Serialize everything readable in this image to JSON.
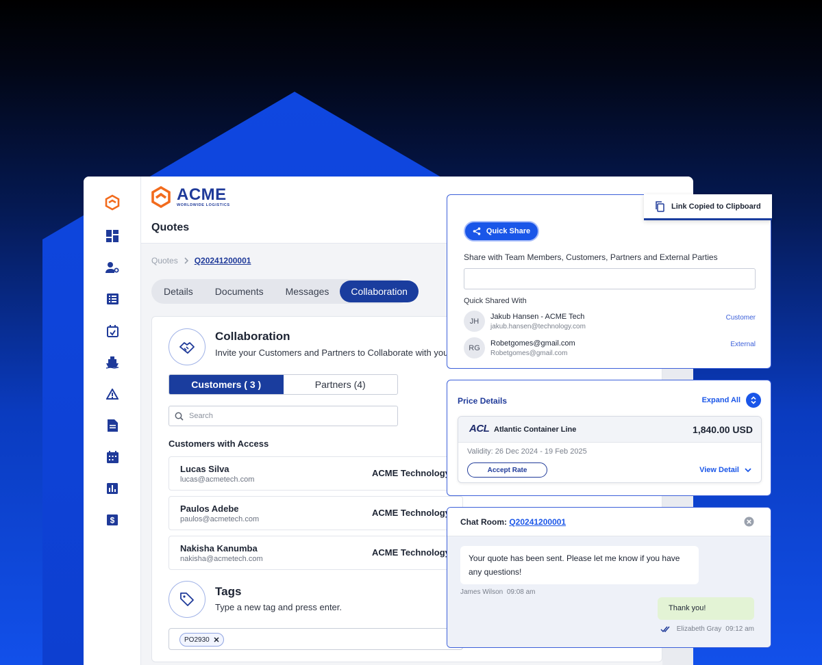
{
  "app": {
    "logo": {
      "name": "ACME",
      "tagline": "WORLDWIDE LOGISTICS"
    },
    "page_title": "Quotes",
    "breadcrumb": {
      "root": "Quotes",
      "current": "Q20241200001"
    },
    "tabs": [
      "Details",
      "Documents",
      "Messages",
      "Collaboration"
    ],
    "active_tab": "Collaboration",
    "sidebar_icons": [
      "acme-logo-icon",
      "dashboard-icon",
      "user-settings-icon",
      "list-icon",
      "calendar-check-icon",
      "ship-icon",
      "warning-icon",
      "document-icon",
      "calendar-icon",
      "bar-chart-icon",
      "dollar-icon"
    ]
  },
  "collaboration": {
    "title": "Collaboration",
    "description": "Invite your Customers and Partners to Collaborate with you",
    "segments": {
      "customers": "Customers ( 3 )",
      "partners": "Partners (4)"
    },
    "search_placeholder": "Search",
    "access_title": "Customers with Access",
    "customers": [
      {
        "name": "Lucas Silva",
        "email": "lucas@acmetech.com",
        "org": "ACME Technology"
      },
      {
        "name": "Paulos Adebe",
        "email": "paulos@acmetech.com",
        "org": "ACME Technology"
      },
      {
        "name": "Nakisha Kanumba",
        "email": "nakisha@acmetech.com",
        "org": "ACME Technology"
      }
    ]
  },
  "tags": {
    "title": "Tags",
    "description": "Type a new tag and press enter.",
    "items": [
      "PO2930"
    ]
  },
  "share": {
    "toast": "Link Copied to Clipboard",
    "button": "Quick Share",
    "label": "Share with Team Members, Customers, Partners and External Parties",
    "shared_with_title": "Quick Shared With",
    "people": [
      {
        "initials": "JH",
        "name": "Jakub Hansen - ACME Tech",
        "email": "jakub.hansen@technology.com",
        "role": "Customer"
      },
      {
        "initials": "RG",
        "name": "Robetgomes@gmail.com",
        "email": "Robetgomes@gmail.com",
        "role": "External"
      }
    ]
  },
  "price": {
    "title": "Price Details",
    "expand": "Expand All",
    "carrier_code": "ACL",
    "carrier": "Atlantic Container Line",
    "amount": "1,840.00 USD",
    "validity": "Validity: 26 Dec 2024 - 19 Feb 2025",
    "accept": "Accept Rate",
    "view": "View Detail"
  },
  "chat": {
    "title_prefix": "Chat Room:",
    "room_id": "Q20241200001",
    "incoming": {
      "text": "Your quote has been sent. Please let me know if you have any questions!",
      "sender": "James Wilson",
      "time": "09:08 am"
    },
    "outgoing": {
      "text": "Thank you!",
      "sender": "Elizabeth Gray",
      "time": "09:12 am"
    }
  },
  "colors": {
    "brand": "#1a3d9e",
    "accent": "#1a56e8",
    "logo_orange": "#f26b1d"
  }
}
